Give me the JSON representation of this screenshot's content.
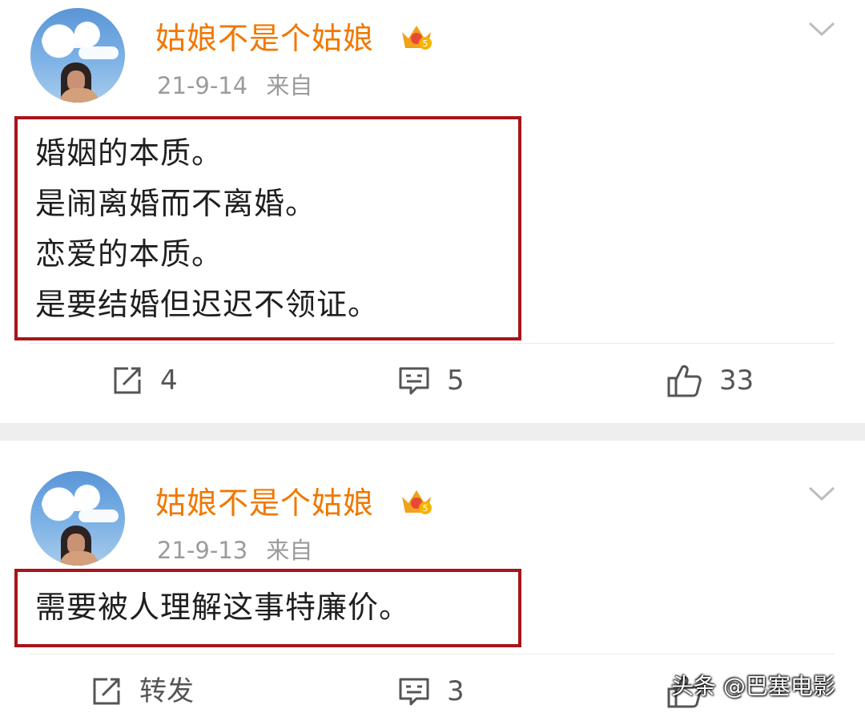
{
  "posts": [
    {
      "username": "姑娘不是个姑娘",
      "crown_level": "5",
      "date": "21-9-14",
      "source_prefix": "来自",
      "lines": [
        "婚姻的本质。",
        "是闹离婚而不离婚。",
        "恋爱的本质。",
        "是要结婚但迟迟不领证。"
      ],
      "repost_count": "4",
      "comment_count": "5",
      "like_count": "33"
    },
    {
      "username": "姑娘不是个姑娘",
      "crown_level": "5",
      "date": "21-9-13",
      "source_prefix": "来自",
      "lines": [
        "需要被人理解这事特廉价。"
      ],
      "repost_label": "转发",
      "comment_count": "3"
    }
  ],
  "watermark": "头条 @巴塞电影",
  "colors": {
    "username": "#f07800",
    "highlight_border": "#a8141a",
    "meta": "#9b9b9b",
    "icon": "#555555"
  },
  "icons": [
    "avatar",
    "crown-icon",
    "chevron-down-icon",
    "repost-icon",
    "comment-icon",
    "like-icon"
  ]
}
